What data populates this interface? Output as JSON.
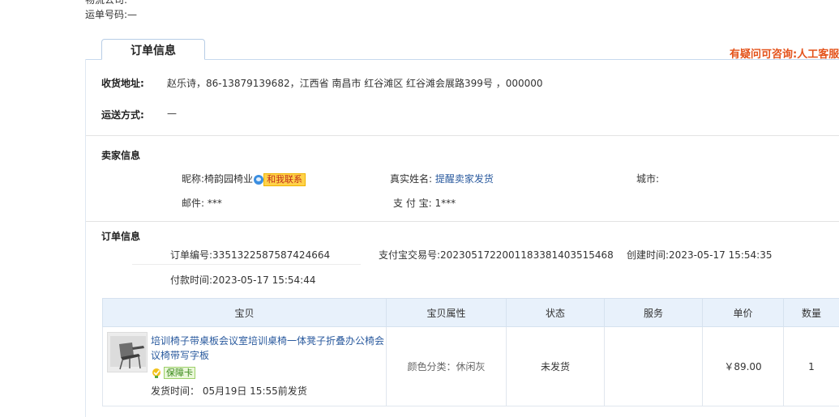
{
  "top": {
    "logistics_label": "物流公司:",
    "waybill_label": "运单号码:",
    "waybill_value": "—"
  },
  "tab": {
    "label": "订单信息"
  },
  "consult": {
    "prefix": "有疑问可咨询:",
    "link": "人工客服"
  },
  "shipping": {
    "address_label": "收货地址:",
    "address_value": "赵乐诗，86-13879139682，江西省 南昌市 红谷滩区 红谷滩会展路399号 ，000000",
    "method_label": "运送方式:",
    "method_value": "—"
  },
  "seller": {
    "section_title": "卖家信息",
    "nickname_label": "昵称:",
    "nickname_value": "椅韵园椅业",
    "contact_badge": "和我联系",
    "realname_label": "真实姓名:",
    "realname_value": "提醒卖家发货",
    "city_label": "城市:",
    "city_value": "",
    "email_label": "邮件:",
    "email_value": "***",
    "alipay_label": "支 付 宝:",
    "alipay_value": "1***"
  },
  "order": {
    "section_title": "订单信息",
    "order_no_label": "订单编号:",
    "order_no_value": "3351322587587424664",
    "alipay_trade_label": "支付宝交易号:",
    "alipay_trade_value": "2023051722001183381403515468",
    "created_label": "创建时间:",
    "created_value": "2023-05-17 15:54:35",
    "paid_label": "付款时间:",
    "paid_value": "2023-05-17 15:54:44"
  },
  "table": {
    "headers": [
      "宝贝",
      "宝贝属性",
      "状态",
      "服务",
      "单价",
      "数量"
    ],
    "rows": [
      {
        "title": "培训椅子带桌板会议室培训桌椅一体凳子折叠办公椅会议椅带写字板",
        "guarantee": "保障卡",
        "ship_time": "发货时间：  05月19日 15:55前发货",
        "attributes": "颜色分类：休闲灰",
        "status": "未发货",
        "service": "",
        "price": "￥89.00",
        "quantity": "1"
      }
    ]
  }
}
